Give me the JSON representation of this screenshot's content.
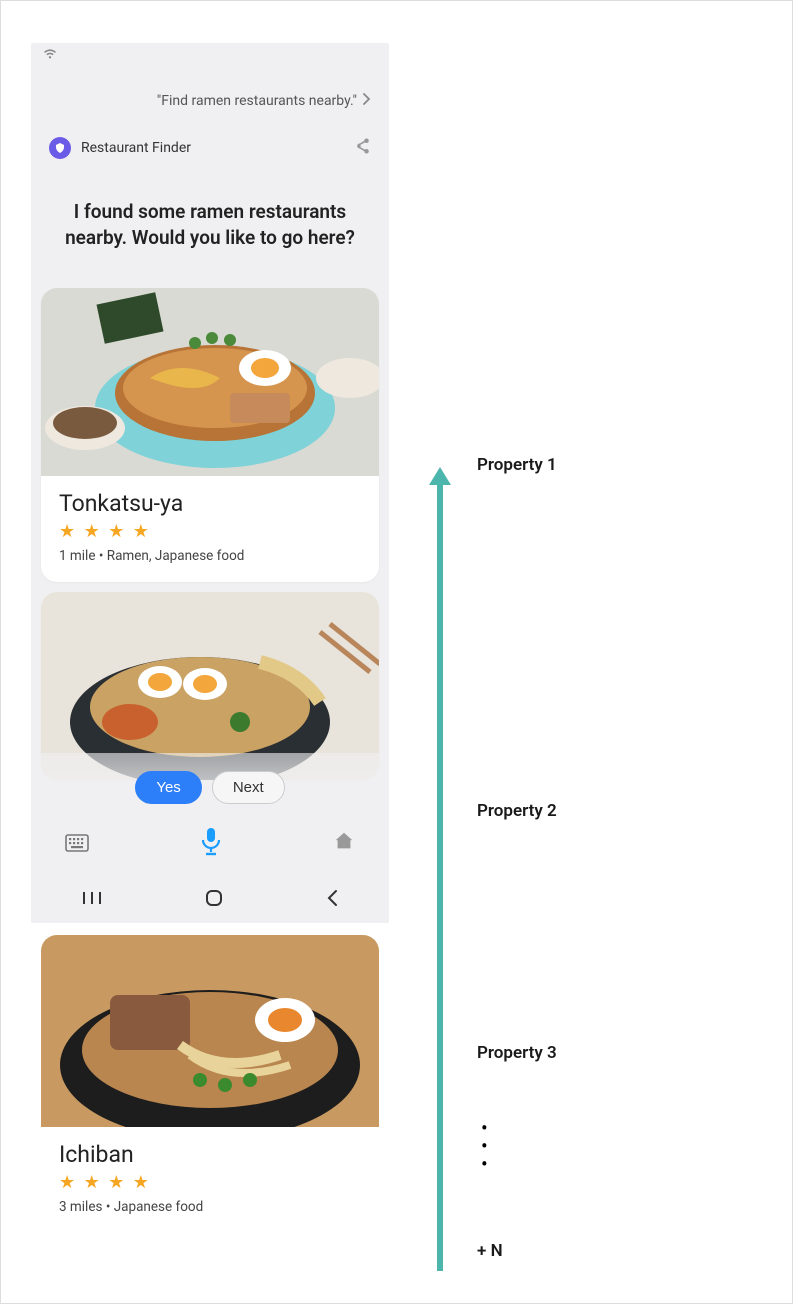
{
  "statusbar": {
    "wifi": "wifi"
  },
  "query": "\"Find ramen restaurants nearby.\"",
  "capsule": {
    "title": "Restaurant Finder"
  },
  "response": "I found some ramen restaurants nearby. Would you like to go here?",
  "cards": [
    {
      "title": "Tonkatsu-ya",
      "stars": "★ ★ ★ ★",
      "subtitle": "1 mile • Ramen, Japanese food"
    },
    {
      "title": "Ichiban",
      "stars": "★ ★ ★ ★",
      "subtitle": "3 miles • Japanese food"
    }
  ],
  "pills": {
    "yes": "Yes",
    "next": "Next"
  },
  "annotations": {
    "p1": "Property 1",
    "p2": "Property 2",
    "p3": "Property 3",
    "plus": "+ N"
  }
}
